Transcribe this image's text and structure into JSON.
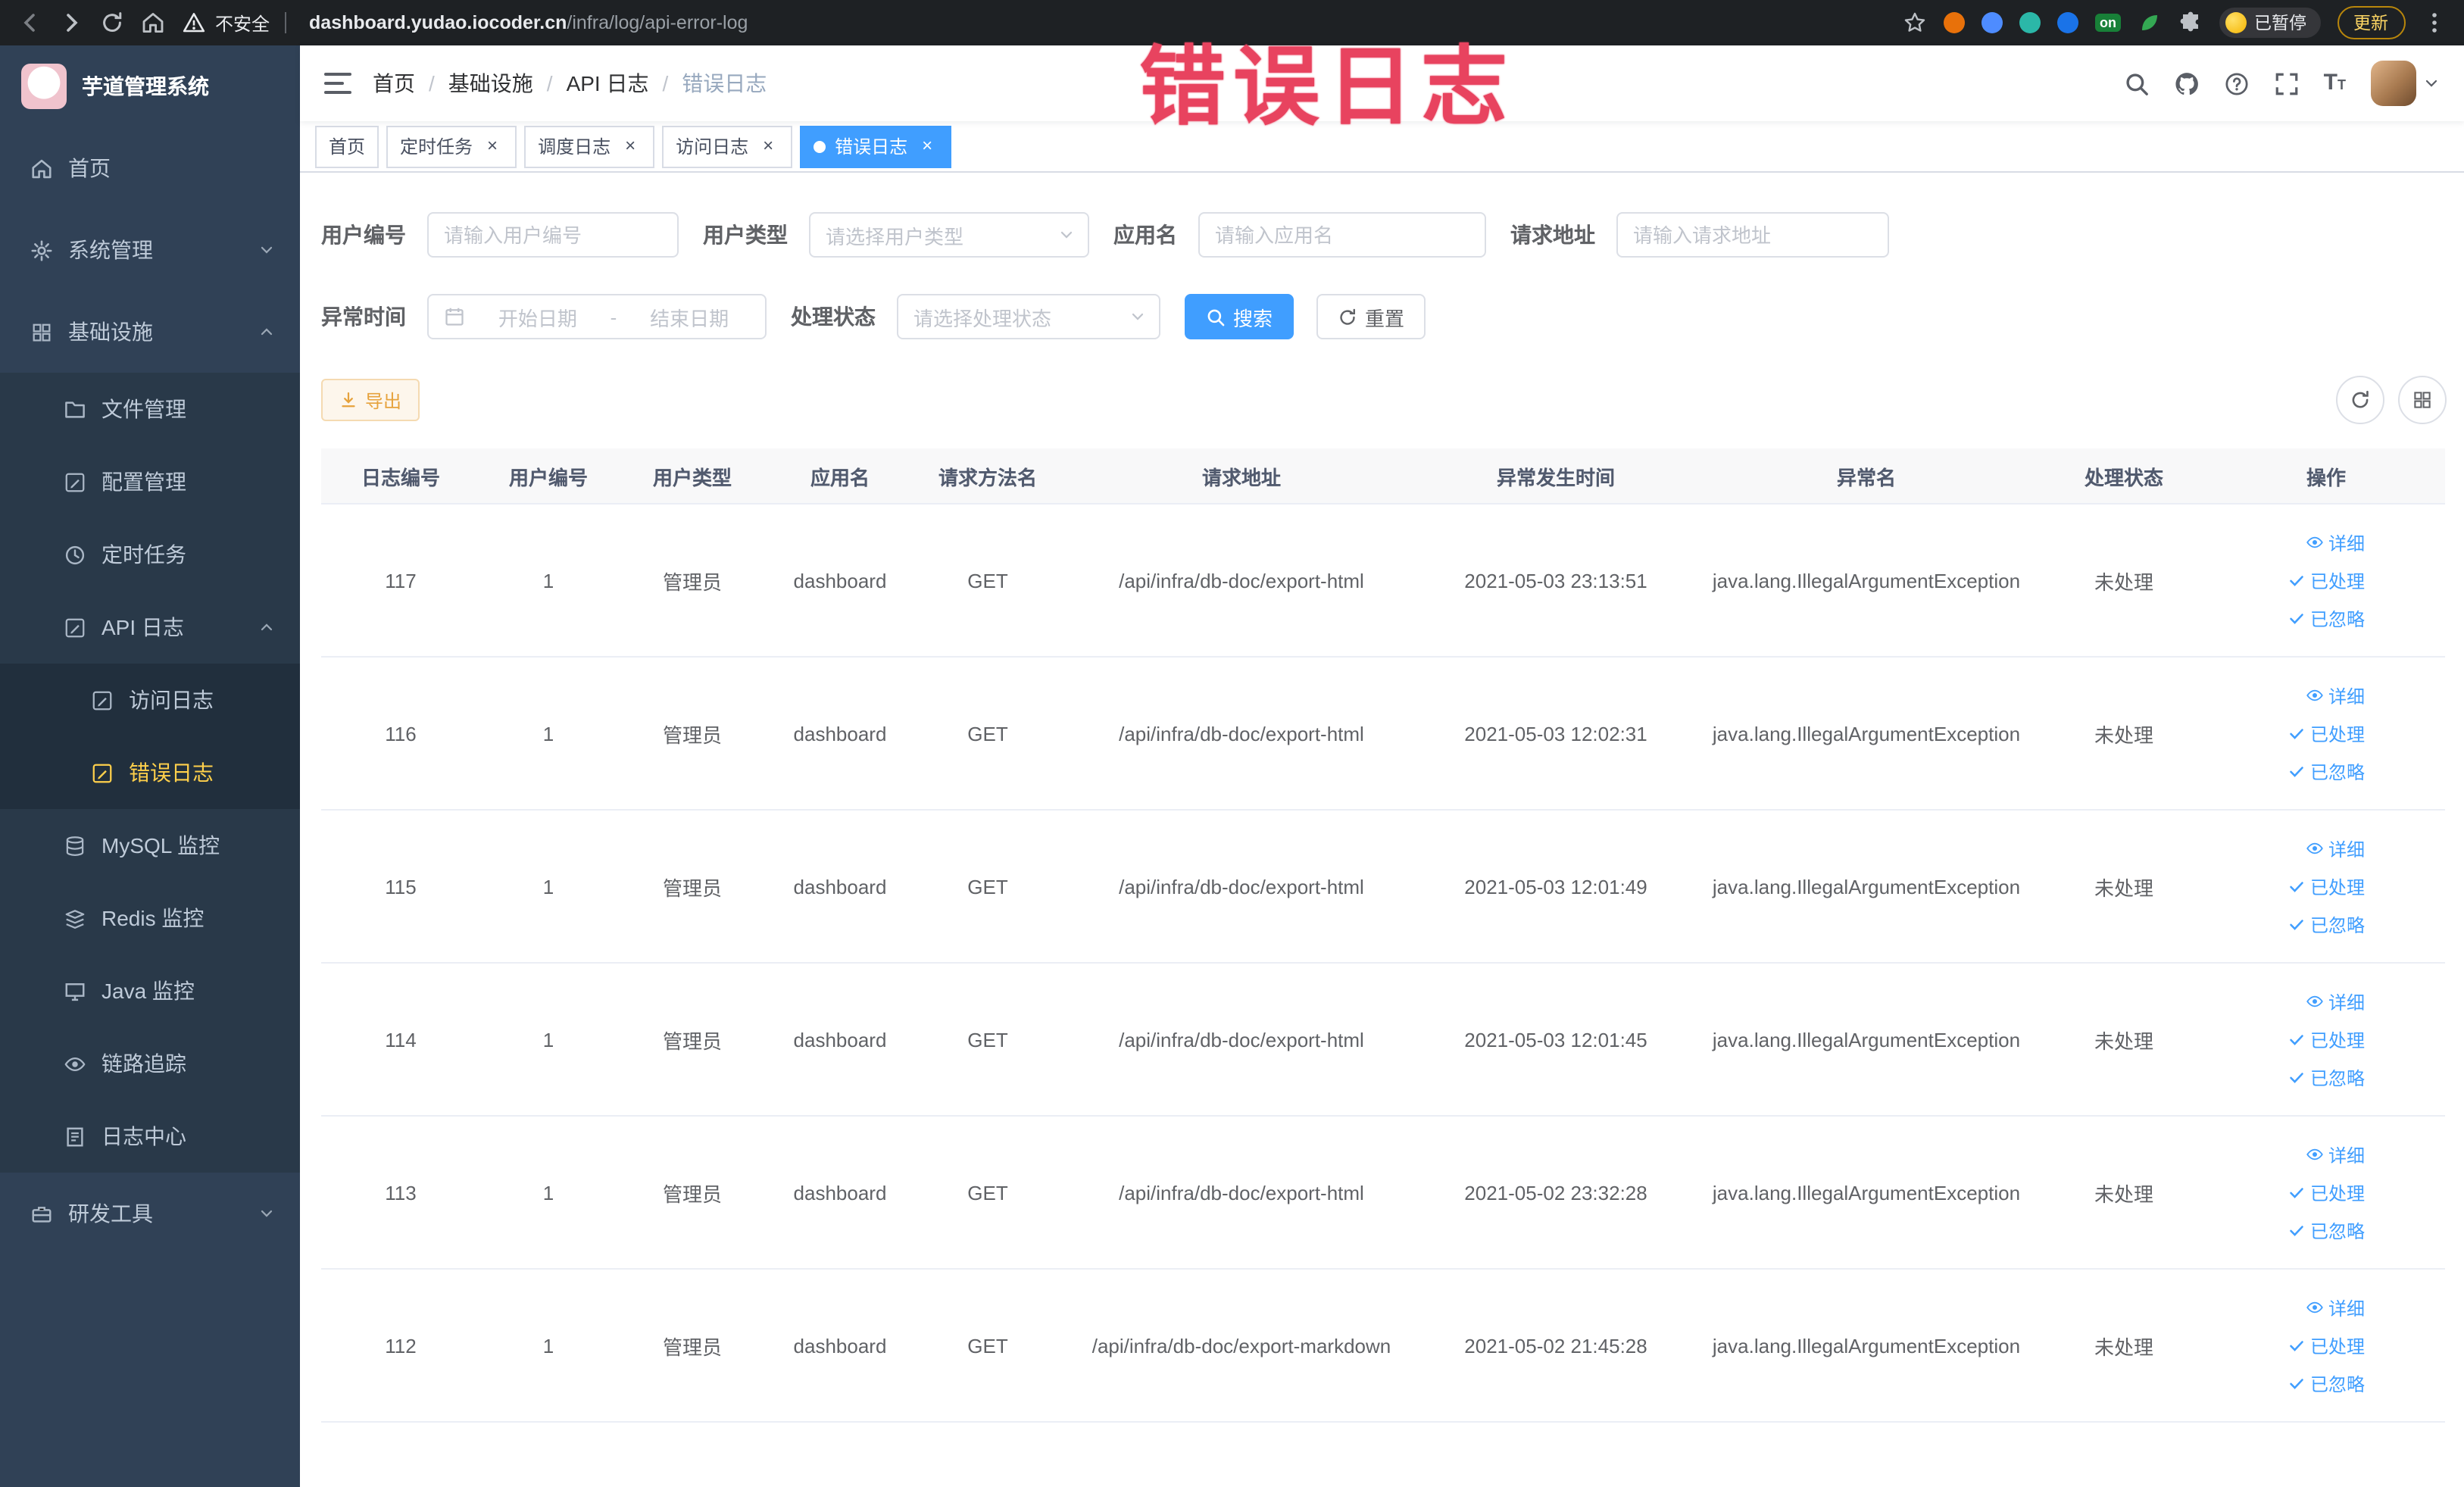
{
  "browser": {
    "security_text": "不安全",
    "url_domain": "dashboard.yudao.iocoder.cn",
    "url_path": "/infra/log/api-error-log",
    "ext_on_badge": "on",
    "paused_badge": "已暂停",
    "update_button": "更新"
  },
  "annotation": {
    "text": "错误日志"
  },
  "sidebar": {
    "logo_title": "芋道管理系统",
    "items": [
      {
        "label": "首页"
      },
      {
        "label": "系统管理"
      },
      {
        "label": "基础设施"
      },
      {
        "label": "文件管理"
      },
      {
        "label": "配置管理"
      },
      {
        "label": "定时任务"
      },
      {
        "label": "API 日志"
      },
      {
        "label": "访问日志"
      },
      {
        "label": "错误日志"
      },
      {
        "label": "MySQL 监控"
      },
      {
        "label": "Redis 监控"
      },
      {
        "label": "Java 监控"
      },
      {
        "label": "链路追踪"
      },
      {
        "label": "日志中心"
      },
      {
        "label": "研发工具"
      }
    ]
  },
  "header": {
    "breadcrumb": [
      "首页",
      "基础设施",
      "API 日志",
      "错误日志"
    ]
  },
  "tabs": [
    {
      "label": "首页"
    },
    {
      "label": "定时任务"
    },
    {
      "label": "调度日志"
    },
    {
      "label": "访问日志"
    },
    {
      "label": "错误日志"
    }
  ],
  "filters": {
    "user_id_label": "用户编号",
    "user_id_placeholder": "请输入用户编号",
    "user_type_label": "用户类型",
    "user_type_placeholder": "请选择用户类型",
    "app_label": "应用名",
    "app_placeholder": "请输入应用名",
    "url_label": "请求地址",
    "url_placeholder": "请输入请求地址",
    "time_label": "异常时间",
    "start_placeholder": "开始日期",
    "range_separator": "-",
    "end_placeholder": "结束日期",
    "status_label": "处理状态",
    "status_placeholder": "请选择处理状态",
    "search_label": "搜索",
    "reset_label": "重置"
  },
  "toolbar": {
    "export_label": "导出"
  },
  "table": {
    "columns": [
      "日志编号",
      "用户编号",
      "用户类型",
      "应用名",
      "请求方法名",
      "请求地址",
      "异常发生时间",
      "异常名",
      "处理状态",
      "操作"
    ],
    "actions": {
      "detail": "详细",
      "processed": "已处理",
      "ignored": "已忽略"
    },
    "rows": [
      {
        "id": "117",
        "user_id": "1",
        "user_type": "管理员",
        "app": "dashboard",
        "method": "GET",
        "url": "/api/infra/db-doc/export-html",
        "time": "2021-05-03 23:13:51",
        "exception": "java.lang.IllegalArgumentException",
        "status": "未处理"
      },
      {
        "id": "116",
        "user_id": "1",
        "user_type": "管理员",
        "app": "dashboard",
        "method": "GET",
        "url": "/api/infra/db-doc/export-html",
        "time": "2021-05-03 12:02:31",
        "exception": "java.lang.IllegalArgumentException",
        "status": "未处理"
      },
      {
        "id": "115",
        "user_id": "1",
        "user_type": "管理员",
        "app": "dashboard",
        "method": "GET",
        "url": "/api/infra/db-doc/export-html",
        "time": "2021-05-03 12:01:49",
        "exception": "java.lang.IllegalArgumentException",
        "status": "未处理"
      },
      {
        "id": "114",
        "user_id": "1",
        "user_type": "管理员",
        "app": "dashboard",
        "method": "GET",
        "url": "/api/infra/db-doc/export-html",
        "time": "2021-05-03 12:01:45",
        "exception": "java.lang.IllegalArgumentException",
        "status": "未处理"
      },
      {
        "id": "113",
        "user_id": "1",
        "user_type": "管理员",
        "app": "dashboard",
        "method": "GET",
        "url": "/api/infra/db-doc/export-html",
        "time": "2021-05-02 23:32:28",
        "exception": "java.lang.IllegalArgumentException",
        "status": "未处理"
      },
      {
        "id": "112",
        "user_id": "1",
        "user_type": "管理员",
        "app": "dashboard",
        "method": "GET",
        "url": "/api/infra/db-doc/export-markdown",
        "time": "2021-05-02 21:45:28",
        "exception": "java.lang.IllegalArgumentException",
        "status": "未处理"
      }
    ]
  }
}
